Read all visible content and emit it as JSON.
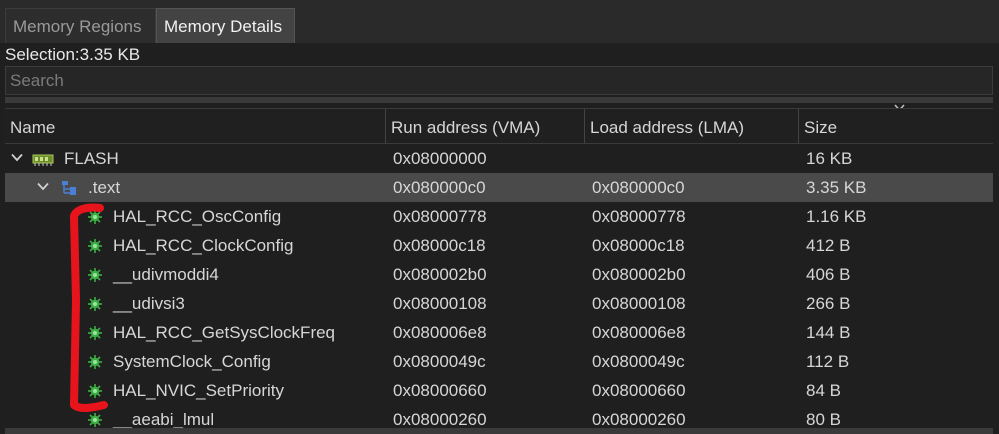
{
  "tabs": [
    {
      "label": "Memory Regions",
      "active": false
    },
    {
      "label": "Memory Details",
      "active": true
    }
  ],
  "selection_text": "Selection:3.35 KB",
  "search": {
    "placeholder": "Search",
    "value": ""
  },
  "columns": {
    "name": "Name",
    "vma": "Run address (VMA)",
    "lma": "Load address (LMA)",
    "size": "Size"
  },
  "sort_indicator_icon": "chevron-down-icon",
  "rows": [
    {
      "name": "FLASH",
      "vma": "0x08000000",
      "lma": "",
      "size": "16 KB",
      "level": 0,
      "expanded": true,
      "icon": "memory-chip-icon"
    },
    {
      "name": ".text",
      "vma": "0x080000c0",
      "lma": "0x080000c0",
      "size": "3.35 KB",
      "level": 1,
      "expanded": true,
      "selected": true,
      "icon": "section-icon"
    },
    {
      "name": "HAL_RCC_OscConfig",
      "vma": "0x08000778",
      "lma": "0x08000778",
      "size": "1.16 KB",
      "level": 2,
      "icon": "symbol-icon"
    },
    {
      "name": "HAL_RCC_ClockConfig",
      "vma": "0x08000c18",
      "lma": "0x08000c18",
      "size": "412 B",
      "level": 2,
      "icon": "symbol-icon"
    },
    {
      "name": "__udivmoddi4",
      "vma": "0x080002b0",
      "lma": "0x080002b0",
      "size": "406 B",
      "level": 2,
      "icon": "symbol-icon"
    },
    {
      "name": "__udivsi3",
      "vma": "0x08000108",
      "lma": "0x08000108",
      "size": "266 B",
      "level": 2,
      "icon": "symbol-icon"
    },
    {
      "name": "HAL_RCC_GetSysClockFreq",
      "vma": "0x080006e8",
      "lma": "0x080006e8",
      "size": "144 B",
      "level": 2,
      "icon": "symbol-icon"
    },
    {
      "name": "SystemClock_Config",
      "vma": "0x0800049c",
      "lma": "0x0800049c",
      "size": "112 B",
      "level": 2,
      "icon": "symbol-icon"
    },
    {
      "name": "HAL_NVIC_SetPriority",
      "vma": "0x08000660",
      "lma": "0x08000660",
      "size": "84 B",
      "level": 2,
      "icon": "symbol-icon"
    },
    {
      "name": "__aeabi_lmul",
      "vma": "0x08000260",
      "lma": "0x08000260",
      "size": "80 B",
      "level": 2,
      "icon": "symbol-icon"
    }
  ],
  "annotation_color": "#e8141c"
}
